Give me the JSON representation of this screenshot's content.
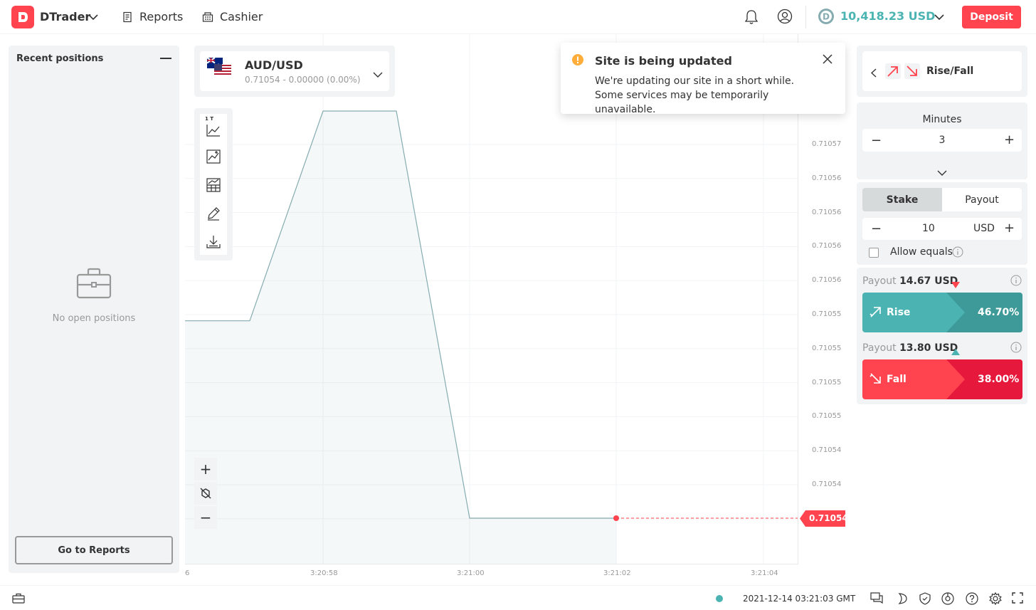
{
  "header": {
    "app_name": "DTrader",
    "reports": "Reports",
    "cashier": "Cashier",
    "balance": "10,418.23 USD",
    "deposit": "Deposit"
  },
  "left_panel": {
    "title": "Recent positions",
    "empty_text": "No open positions",
    "go_to_reports": "Go to Reports"
  },
  "asset": {
    "name": "AUD/USD",
    "quote": "0.71054 - 0.00000 (0.00%)"
  },
  "toolbar": {
    "interval_label": "1 T"
  },
  "chart_data": {
    "type": "line",
    "x": [
      "3:20:57",
      "3:20:58",
      "3:20:59",
      "3:21:00",
      "3:21:01",
      "3:21:02",
      "3:21:03"
    ],
    "y": [
      0.710556,
      0.710556,
      0.710573,
      0.710573,
      0.71054,
      0.71054,
      0.71054
    ],
    "y_tick_labels": [
      "0.71057",
      "0.71056",
      "0.71056",
      "0.71056",
      "0.71056",
      "0.71055",
      "0.71055",
      "0.71055",
      "0.71055",
      "0.71054",
      "0.71054",
      "0.71054"
    ],
    "x_tick_labels": [
      "6",
      "3:20:58",
      "3:21:00",
      "3:21:02",
      "3:21:04"
    ],
    "current_price": "0.71054",
    "grid": true,
    "line_color": "#85acb0",
    "marker_color": "#ff444f"
  },
  "notification": {
    "title": "Site is being updated",
    "message": "We're updating our site in a short while. Some services may be temporarily unavailable."
  },
  "trade": {
    "contract_type": "Rise/Fall",
    "duration_unit": "Minutes",
    "duration_value": "3",
    "tab_stake": "Stake",
    "tab_payout": "Payout",
    "amount": "10",
    "currency": "USD",
    "allow_equals": "Allow equals",
    "rise": {
      "payout_label": "Payout",
      "payout_value": "14.67 USD",
      "button": "Rise",
      "percent": "46.70%",
      "color": "#4bb4b3"
    },
    "fall": {
      "payout_label": "Payout",
      "payout_value": "13.80 USD",
      "button": "Fall",
      "percent": "38.00%",
      "color": "#ff444f"
    }
  },
  "footer": {
    "server_time": "2021-12-14 03:21:03 GMT"
  }
}
